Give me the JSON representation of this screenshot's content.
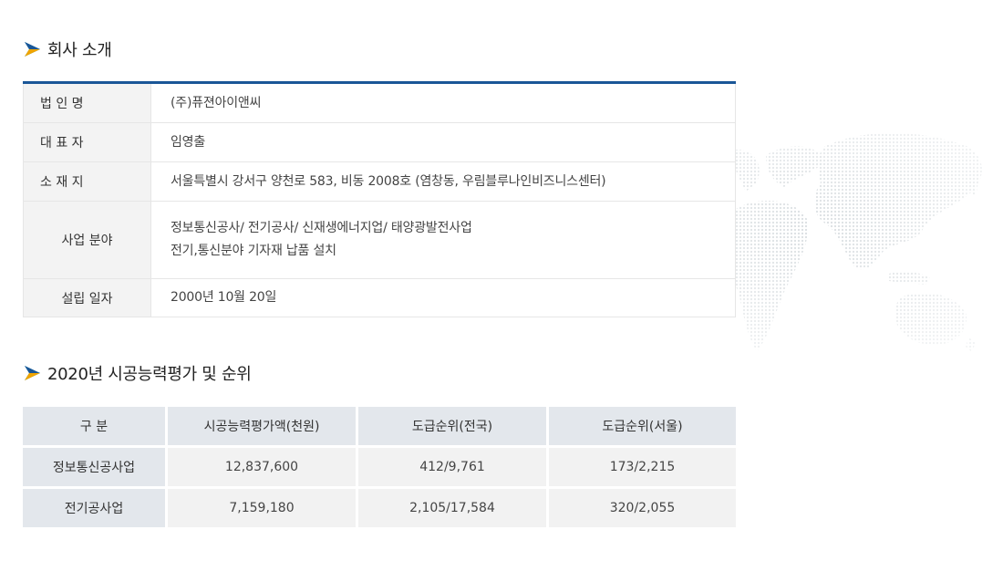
{
  "company_section": {
    "title": "회사 소개",
    "rows": [
      {
        "label": "법 인 명",
        "lines": [
          "(주)퓨젼아이앤씨"
        ]
      },
      {
        "label": "대 표 자",
        "lines": [
          "임영출"
        ]
      },
      {
        "label": "소 재 지",
        "lines": [
          "서울특별시 강서구 양천로 583, 비동 2008호 (염창동, 우림블루나인비즈니스센터)"
        ]
      },
      {
        "label": "사업 분야",
        "lines": [
          "정보통신공사/ 전기공사/ 신재생에너지업/ 태양광발전사업",
          "전기,통신분야 기자재 납품 설치"
        ]
      },
      {
        "label": "설립 일자",
        "lines": [
          "2000년 10월 20일"
        ]
      }
    ]
  },
  "ranking_section": {
    "title": "2020년 시공능력평가 및 순위",
    "headers": [
      "구 분",
      "시공능력평가액(천원)",
      "도급순위(전국)",
      "도급순위(서울)"
    ],
    "rows": [
      [
        "정보통신공사업",
        "12,837,600",
        "412/9,761",
        "173/2,215"
      ],
      [
        "전기공사업",
        "7,159,180",
        "2,105/17,584",
        "320/2,055"
      ]
    ]
  },
  "colors": {
    "accent_blue": "#1a5697",
    "arrow_teal": "#1aa3c9",
    "header_bg": "#e3e7ec",
    "label_bg": "#f3f3f3"
  },
  "icons": {
    "section_arrow": "arrow-icon",
    "background": "world-map-icon"
  }
}
